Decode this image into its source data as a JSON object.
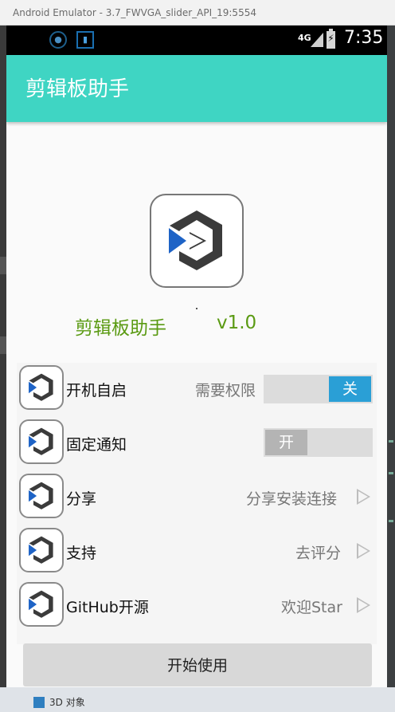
{
  "window": {
    "title": "Android Emulator - 3.7_FWVGA_slider_API_19:5554"
  },
  "desktop": {
    "taskbar_label": "3D 对象"
  },
  "status_bar": {
    "network": "4G",
    "time": "7:35"
  },
  "app_bar": {
    "title": "剪辑板助手"
  },
  "about": {
    "app_name": "剪辑板助手",
    "version": "v1.0"
  },
  "settings": [
    {
      "label": "开机自启",
      "value": "需要权限",
      "toggle": "关",
      "toggle_state": "on"
    },
    {
      "label": "固定通知",
      "toggle": "开",
      "toggle_state": "off"
    },
    {
      "label": "分享",
      "value": "分享安装连接"
    },
    {
      "label": "支持",
      "value": "去评分"
    },
    {
      "label": "GitHub开源",
      "value": "欢迎Star"
    }
  ],
  "start_button": {
    "label": "开始使用"
  },
  "colors": {
    "accent": "#3fd5c3",
    "toggle_on": "#2a9fd6",
    "app_name_green": "#5a9a12"
  },
  "icons": [
    "app-logo-icon",
    "chevron-right-icon",
    "signal-icon",
    "battery-charging-icon"
  ]
}
